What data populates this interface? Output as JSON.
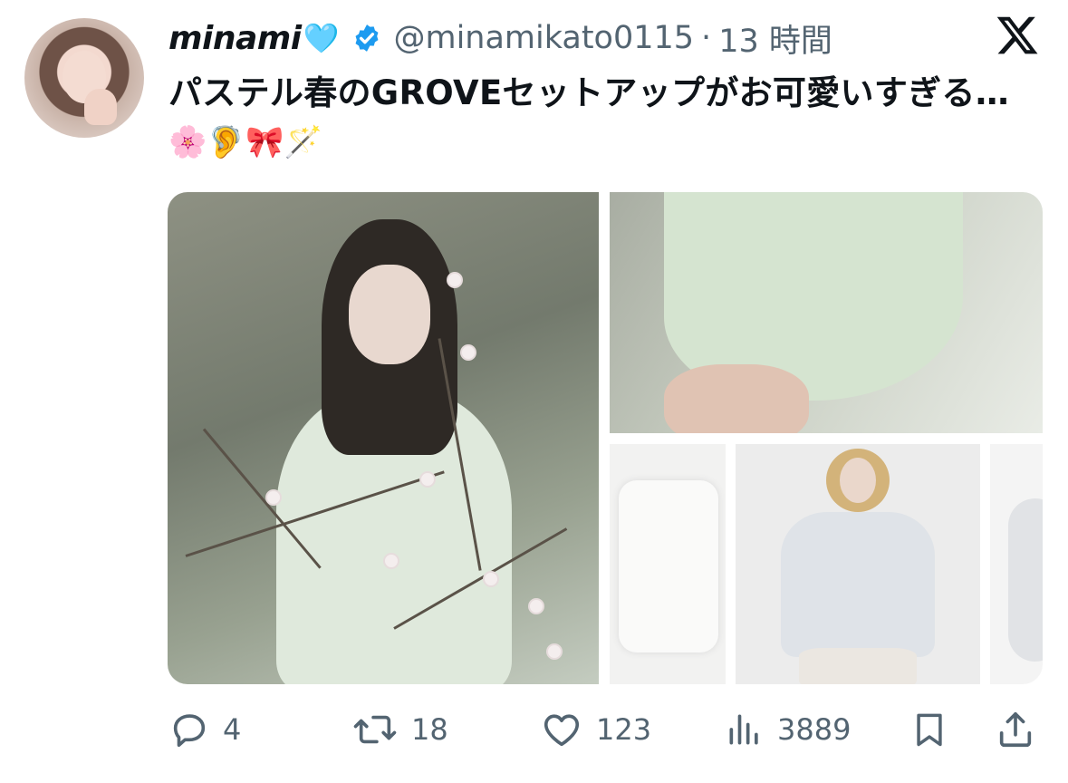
{
  "author": {
    "name": "minami",
    "name_emoji": "🩵",
    "handle": "@minamikato0115",
    "separator": "·",
    "time": "13 時間"
  },
  "tweet": {
    "text": "パステル春のGROVEセットアップがお可愛いすぎる…",
    "emojis": "🌸🦻🎀🪄"
  },
  "actions": {
    "replies": "4",
    "retweets": "18",
    "likes": "123",
    "views": "3889"
  },
  "icons": {
    "verified": "verified-badge-icon",
    "platform": "x-logo-icon",
    "reply": "reply-icon",
    "retweet": "retweet-icon",
    "like": "heart-icon",
    "views": "views-chart-icon",
    "bookmark": "bookmark-icon",
    "share": "share-icon"
  },
  "colors": {
    "verified_blue": "#1d9bf0",
    "secondary_text": "#536471",
    "primary_text": "#0f1419"
  }
}
